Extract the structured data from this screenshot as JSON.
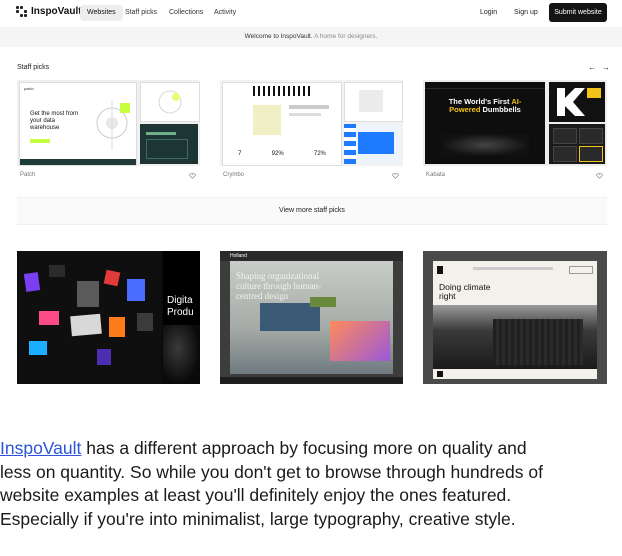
{
  "brand": {
    "name": "InspoVault"
  },
  "nav": {
    "tabs": [
      {
        "label": "Websites",
        "active": true
      },
      {
        "label": "Staff picks",
        "active": false
      },
      {
        "label": "Collections",
        "active": false
      },
      {
        "label": "Activity",
        "active": false
      }
    ],
    "login": "Login",
    "signup": "Sign up",
    "submit": "Submit website"
  },
  "banner": {
    "title": "Welcome to InspoVault.",
    "subtitle": "A home for designers."
  },
  "staff_picks": {
    "title": "Staff picks",
    "prev_arrow": "←",
    "next_arrow": "→",
    "cards": [
      {
        "name": "Patch",
        "headline": "Get the most from your data warehouse",
        "logo_text": "patch"
      },
      {
        "name": "Crymbo",
        "stats": [
          "7",
          "92%",
          "72%"
        ]
      },
      {
        "name": "Kabata",
        "headline": "The World's First AI-Powered Dumbbells",
        "highlight": "AI-Powered"
      }
    ],
    "view_more": "View more staff picks"
  },
  "gallery": [
    {
      "label": "Digital Products",
      "words": [
        "Digita",
        "Produ"
      ]
    },
    {
      "brand": "Holland",
      "headline": "Shaping organizational culture through human-centred design"
    },
    {
      "headline": "Doing climate right"
    }
  ],
  "article": {
    "link_text": "InspoVault",
    "line1_rest": " has a different approach by focusing more on quality and",
    "line2": "less on quantity. So while you don't get to browse through hundreds of",
    "line3": "website examples at least you'll definitely enjoy the ones featured.",
    "line4": "Especially if you're into minimalist, large typography, creative style."
  },
  "colors": {
    "accent": "#2b55d6",
    "dark": "#141414",
    "kabata_yellow": "#f3c318"
  }
}
